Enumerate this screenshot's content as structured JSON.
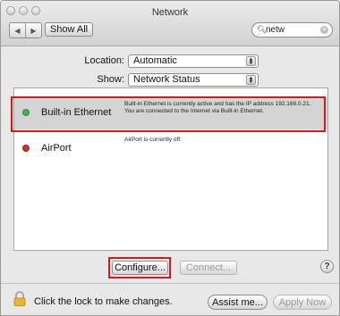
{
  "window": {
    "title": "Network"
  },
  "toolbar": {
    "back_icon": "◀",
    "forward_icon": "▶",
    "show_all_label": "Show All",
    "search": {
      "value": "netw",
      "placeholder": ""
    }
  },
  "location": {
    "label": "Location:",
    "value": "Automatic"
  },
  "show": {
    "label": "Show:",
    "value": "Network Status"
  },
  "services": [
    {
      "name": "Built-in Ethernet",
      "status": "connected",
      "status_color": "#3cb64a",
      "description": "Built-in Ethernet is currently active and has the IP address 192.168.0.21. You are connected to the Internet via Built-in Ethernet.",
      "selected": true
    },
    {
      "name": "AirPort",
      "status": "off",
      "status_color": "#dc2b2b",
      "description": "AirPort is currently off.",
      "selected": false
    }
  ],
  "buttons": {
    "configure_label": "Configure...",
    "connect_label": "Connect...",
    "help_label": "?",
    "assist_label": "Assist me...",
    "apply_label": "Apply Now"
  },
  "lock": {
    "message": "Click the lock to make changes."
  },
  "colors": {
    "highlight": "#d61a1a",
    "selection": "#d4d4d4"
  }
}
